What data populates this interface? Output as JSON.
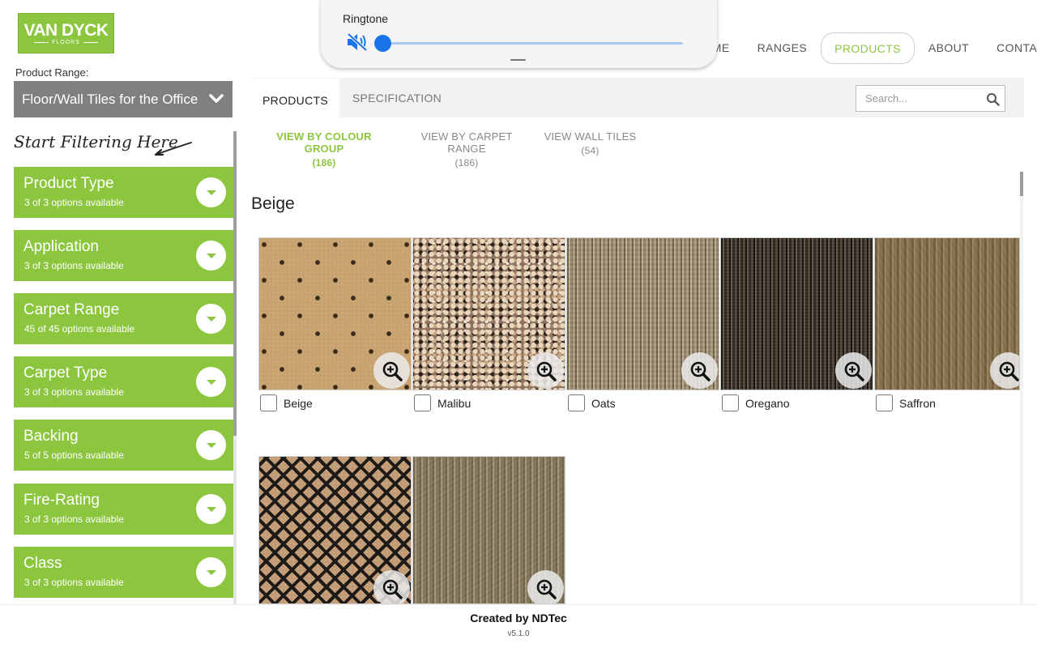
{
  "header": {
    "logo_brand": "VAN DYCK",
    "logo_sub": "FLOORS",
    "nav": [
      "HOME",
      "RANGES",
      "PRODUCTS",
      "ABOUT",
      "CONTACT"
    ]
  },
  "range": {
    "label": "Product Range:",
    "selected": "Floor/Wall Tiles for the Office"
  },
  "tabs": [
    "PRODUCTS",
    "SPECIFICATION"
  ],
  "search": {
    "placeholder": "Search..."
  },
  "sidebar": {
    "hint": "Start Filtering Here",
    "filters": [
      {
        "title": "Product Type",
        "sub": "3 of 3 options available"
      },
      {
        "title": "Application",
        "sub": "3 of 3 options available"
      },
      {
        "title": "Carpet Range",
        "sub": "45 of 45 options available"
      },
      {
        "title": "Carpet Type",
        "sub": "3 of 3 options available"
      },
      {
        "title": "Backing",
        "sub": "5 of 5 options available"
      },
      {
        "title": "Fire-Rating",
        "sub": "3 of 3 options available"
      },
      {
        "title": "Class",
        "sub": "3 of 3 options available"
      }
    ]
  },
  "subtabs": [
    {
      "label": "VIEW BY COLOUR GROUP",
      "count": "(186)"
    },
    {
      "label": "VIEW BY CARPET RANGE",
      "count": "(186)"
    },
    {
      "label": "VIEW WALL TILES",
      "count": "(54)"
    }
  ],
  "group_title": "Beige",
  "products": [
    {
      "name": "Beige",
      "swatch": "dotted-tan"
    },
    {
      "name": "Malibu",
      "swatch": "speckled"
    },
    {
      "name": "Oats",
      "swatch": "ribbed-light"
    },
    {
      "name": "Oregano",
      "swatch": "ribbed-dark"
    },
    {
      "name": "Saffron",
      "swatch": "loop-olive"
    },
    {
      "name": "",
      "swatch": "diamond-lattice"
    },
    {
      "name": "",
      "swatch": "loop-moss"
    }
  ],
  "footer": {
    "credit": "Created by NDTec",
    "version": "v5.1.0"
  },
  "volume_panel": {
    "title": "Ringtone",
    "level": 0,
    "muted": true
  },
  "colors": {
    "accent": "#8cc63f",
    "range_select_bg": "#808080",
    "slider": "#1a73e8"
  }
}
